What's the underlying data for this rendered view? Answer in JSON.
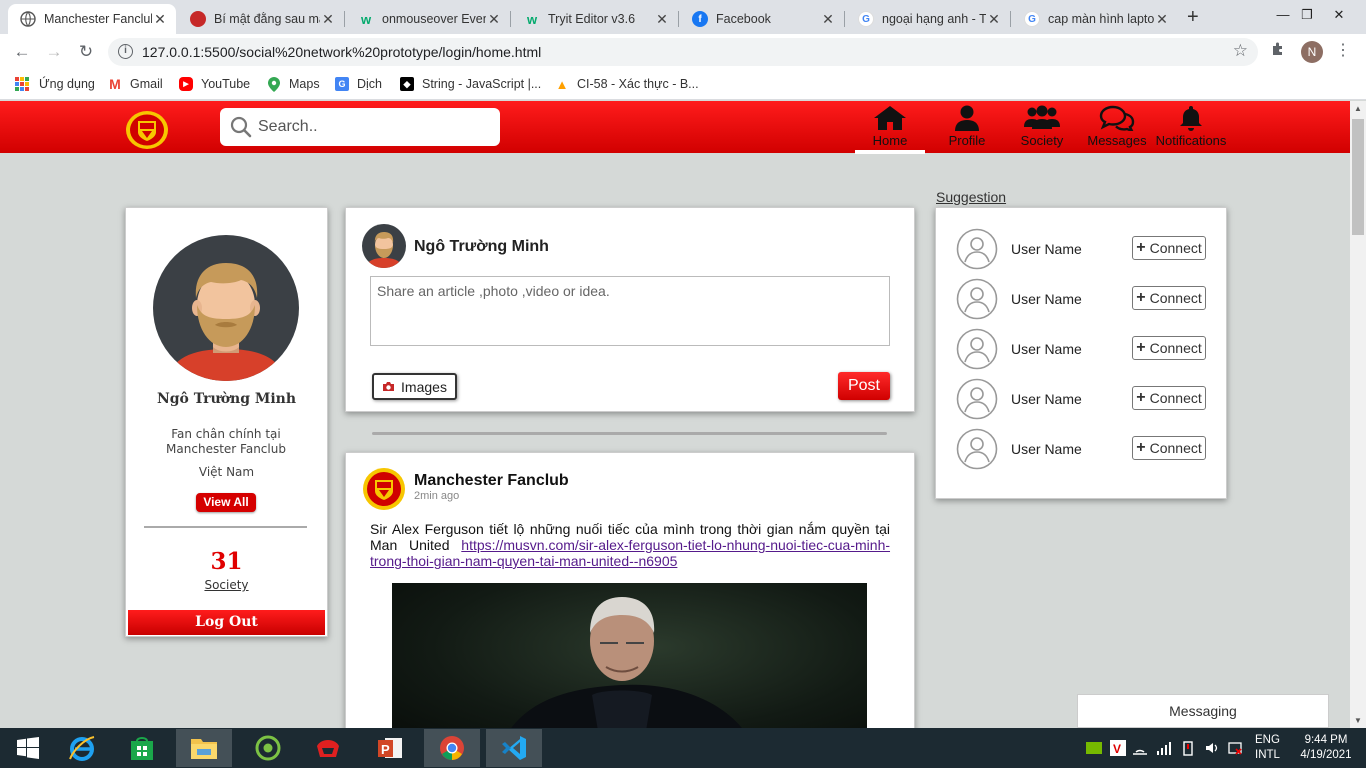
{
  "browser": {
    "tabs": [
      {
        "title": "Manchester Fanclub",
        "active": true,
        "favicon": "globe-icon"
      },
      {
        "title": "Bí mật đằng sau mấ",
        "active": false,
        "favicon": "manutd-crest-icon"
      },
      {
        "title": "onmouseover Event",
        "active": false,
        "favicon": "w3schools-icon"
      },
      {
        "title": "Tryit Editor v3.6",
        "active": false,
        "favicon": "w3schools-icon"
      },
      {
        "title": "Facebook",
        "active": false,
        "favicon": "facebook-icon"
      },
      {
        "title": "ngoại hạng anh - T",
        "active": false,
        "favicon": "google-icon"
      },
      {
        "title": "cap màn hình lapto",
        "active": false,
        "favicon": "google-icon"
      }
    ],
    "url": "127.0.0.1:5500/social%20network%20prototype/login/home.html",
    "profile_initial": "N",
    "bookmarks": [
      {
        "label": "Ứng dụng",
        "icon": "apps-grid-icon"
      },
      {
        "label": "Gmail",
        "icon": "gmail-icon"
      },
      {
        "label": "YouTube",
        "icon": "youtube-icon"
      },
      {
        "label": "Maps",
        "icon": "maps-pin-icon"
      },
      {
        "label": "Dịch",
        "icon": "translate-icon"
      },
      {
        "label": "String - JavaScript |...",
        "icon": "mdn-icon"
      },
      {
        "label": "CI-58 - Xác thực - B...",
        "icon": "firebase-icon"
      }
    ]
  },
  "header": {
    "search_placeholder": "Search..",
    "nav": [
      {
        "label": "Home",
        "icon": "home-icon",
        "active": true
      },
      {
        "label": "Profile",
        "icon": "user-icon",
        "active": false
      },
      {
        "label": "Society",
        "icon": "users-group-icon",
        "active": false
      },
      {
        "label": "Messages",
        "icon": "chat-bubbles-icon",
        "active": false
      },
      {
        "label": "Notifications",
        "icon": "bell-icon",
        "active": false
      }
    ]
  },
  "profile_card": {
    "name": "Ngô Trường Minh",
    "bio": "Fan chân chính tại Manchester Fanclub",
    "country": "Việt Nam",
    "view_all_label": "View All",
    "society_count": "31",
    "society_label": "Society",
    "logout_label": "Log Out"
  },
  "composer": {
    "user_name": "Ngô Trường Minh",
    "placeholder": "Share an article ,photo ,video or idea.",
    "images_label": "Images",
    "post_label": "Post"
  },
  "post": {
    "author": "Manchester Fanclub",
    "time": "2min ago",
    "text": "Sir Alex Ferguson tiết lộ những nuối tiếc của mình trong thời gian nắm quyền tại Man United",
    "link": "https://musvn.com/sir-alex-ferguson-tiet-lo-nhung-nuoi-tiec-cua-minh-trong-thoi-gian-nam-quyen-tai-man-united--n6905"
  },
  "suggestion": {
    "title": "Suggestion",
    "items": [
      {
        "name": "User Name",
        "action": "Connect"
      },
      {
        "name": "User Name",
        "action": "Connect"
      },
      {
        "name": "User Name",
        "action": "Connect"
      },
      {
        "name": "User Name",
        "action": "Connect"
      },
      {
        "name": "User Name",
        "action": "Connect"
      }
    ]
  },
  "messaging_label": "Messaging",
  "taskbar": {
    "lang_line1": "ENG",
    "lang_line2": "INTL",
    "time": "9:44 PM",
    "date": "4/19/2021"
  },
  "colors": {
    "brand_red": "#e00000",
    "page_bg": "#d5d9d7",
    "link": "#551a8b"
  }
}
